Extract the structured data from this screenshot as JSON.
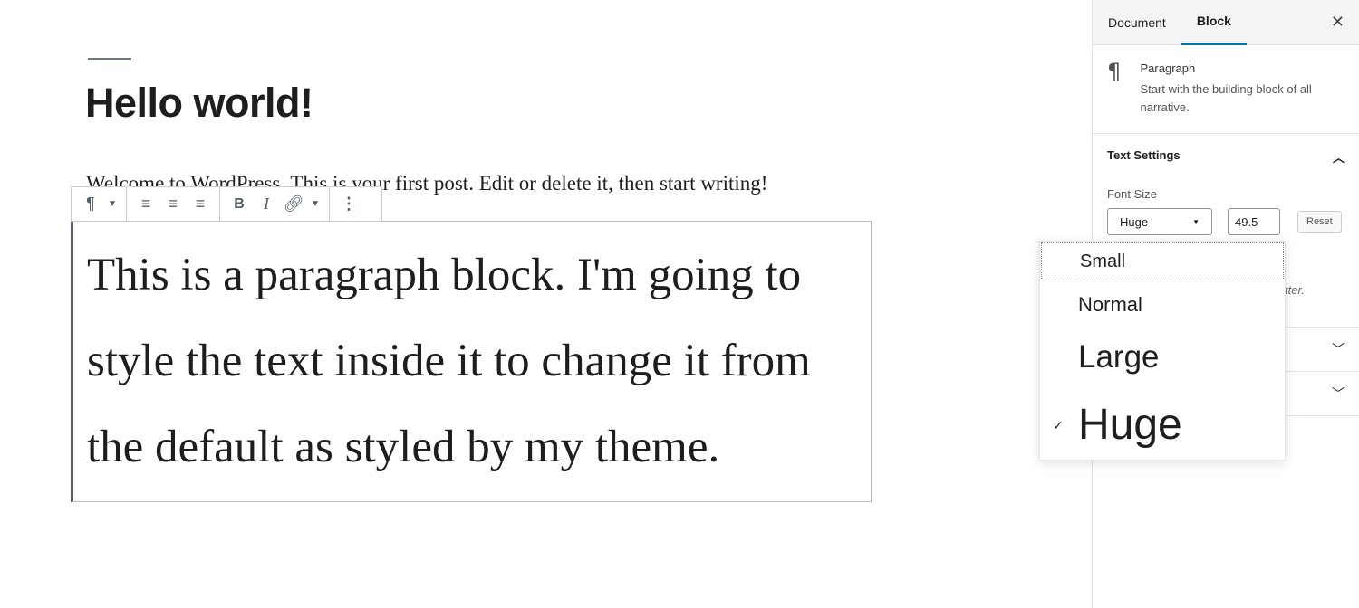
{
  "editor": {
    "title": "Hello world!",
    "welcome": "Welcome to WordPress. This is your first post. Edit or delete it, then start writing!",
    "block_text": "This is a paragraph block. I'm going to style the text inside it to change it from the default as styled by my theme."
  },
  "toolbar": {
    "icons": [
      "paragraph-icon",
      "align-left-icon",
      "align-center-icon",
      "align-right-icon",
      "bold-icon",
      "italic-icon",
      "link-icon",
      "more-icon"
    ],
    "bold": "B",
    "italic": "I"
  },
  "sidebar": {
    "tabs": [
      {
        "label": "Document"
      },
      {
        "label": "Block"
      }
    ],
    "active_tab": "Block",
    "block_name": "Paragraph",
    "block_desc": "Start with the building block of all narrative.",
    "text_settings": "Text Settings",
    "font_size_label": "Font Size",
    "font_size_selected": "Huge",
    "font_size_value": "49.5",
    "reset": "Reset",
    "hint_fragment": "tter."
  },
  "dropdown": {
    "options": [
      {
        "label": "Small"
      },
      {
        "label": "Normal"
      },
      {
        "label": "Large"
      },
      {
        "label": "Huge"
      }
    ],
    "selected": "Huge",
    "check": "✓"
  },
  "colors": {
    "accent": "#0073aa"
  }
}
